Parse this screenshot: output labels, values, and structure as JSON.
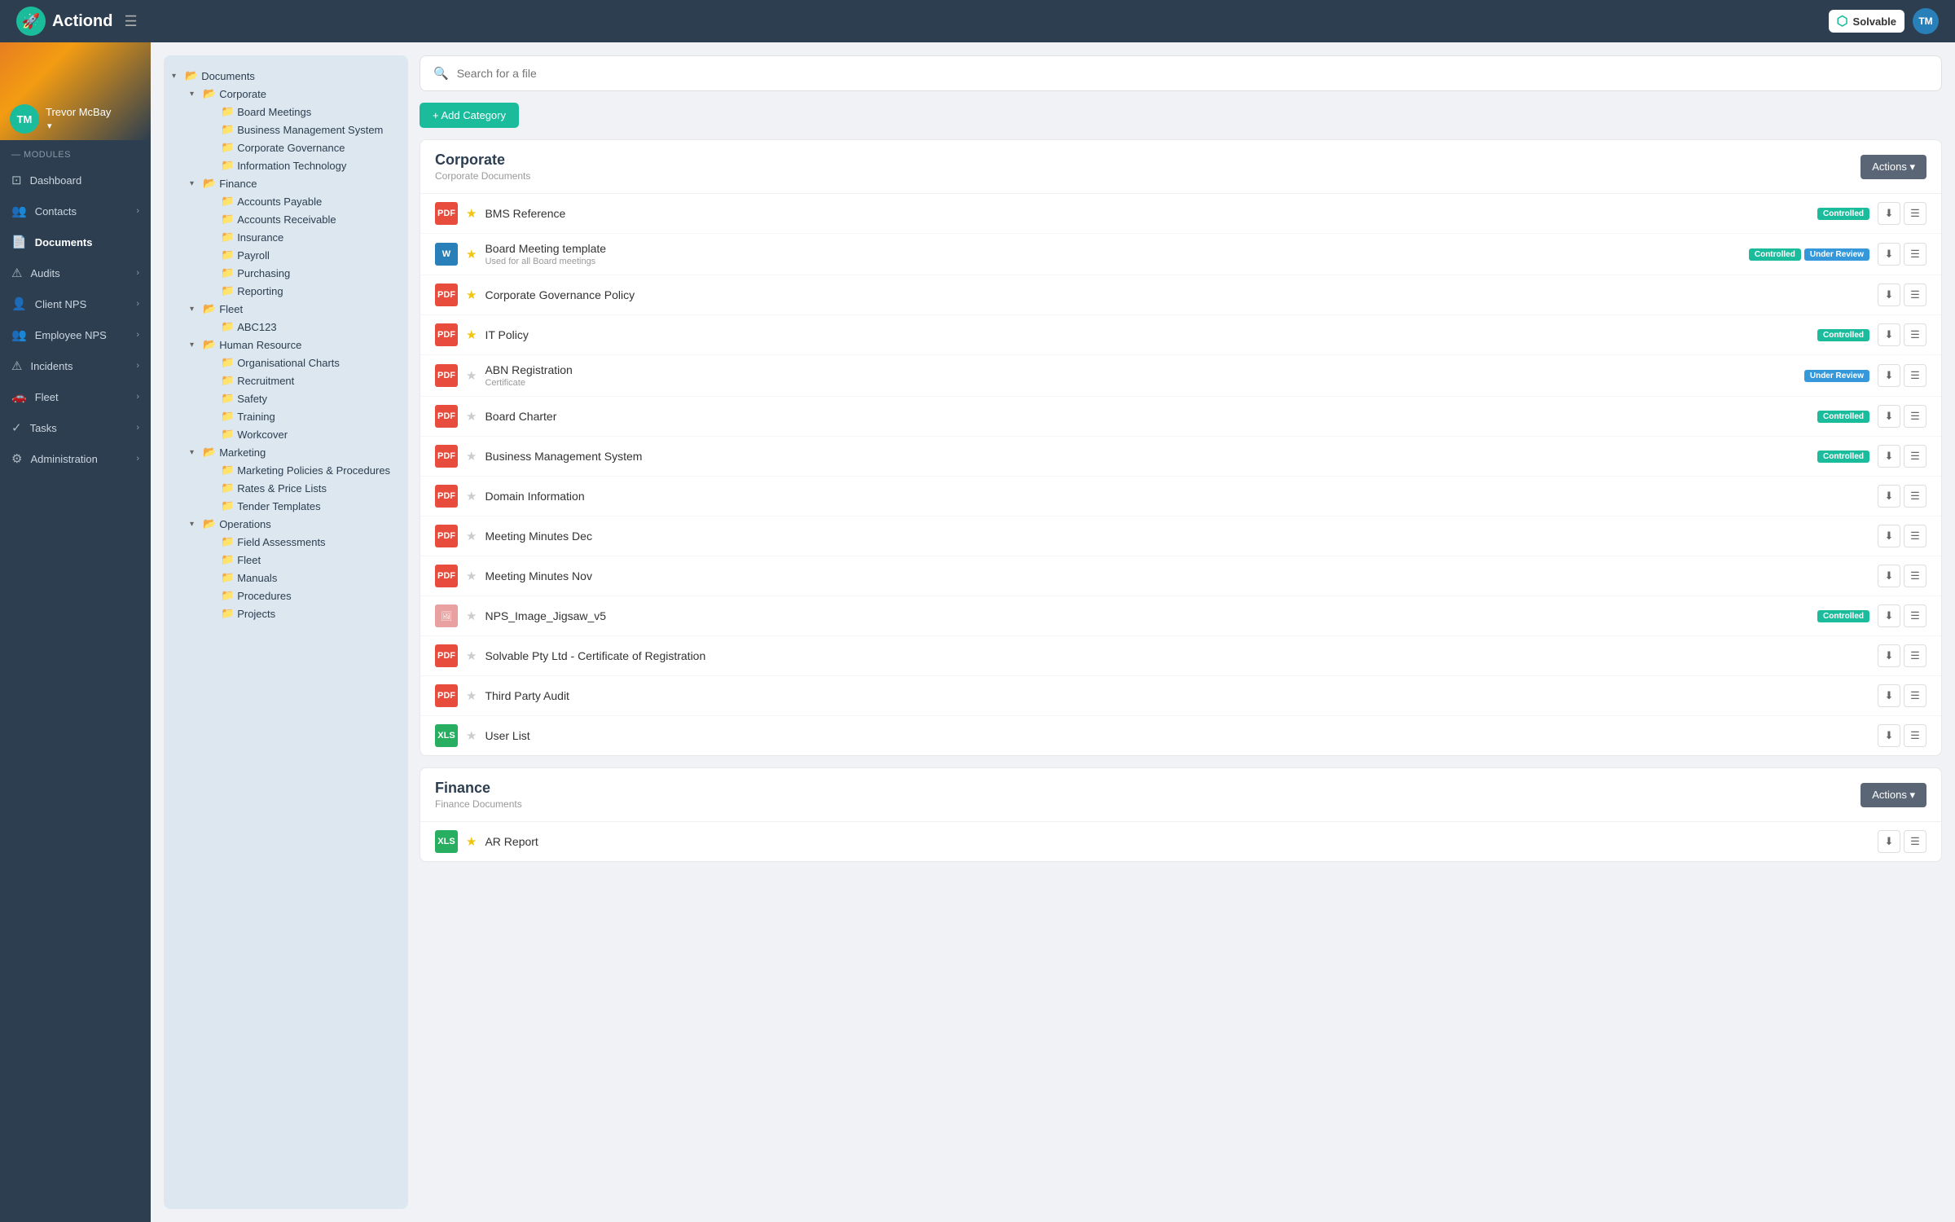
{
  "topNav": {
    "logoIcon": "🚀",
    "appName": "Actiond",
    "hamburgerIcon": "☰",
    "solvableLabel": "Solvable",
    "tmLabel": "TM"
  },
  "sidebar": {
    "userInitials": "TM",
    "userName": "Trevor McBay",
    "modulesLabel": "— MODULES",
    "items": [
      {
        "id": "dashboard",
        "label": "Dashboard",
        "icon": "⊡",
        "hasChevron": false
      },
      {
        "id": "contacts",
        "label": "Contacts",
        "icon": "👥",
        "hasChevron": true
      },
      {
        "id": "documents",
        "label": "Documents",
        "icon": "📄",
        "hasChevron": false,
        "active": true
      },
      {
        "id": "audits",
        "label": "Audits",
        "icon": "⚠",
        "hasChevron": true
      },
      {
        "id": "client-nps",
        "label": "Client NPS",
        "icon": "👤",
        "hasChevron": true
      },
      {
        "id": "employee-nps",
        "label": "Employee NPS",
        "icon": "👥",
        "hasChevron": true
      },
      {
        "id": "incidents",
        "label": "Incidents",
        "icon": "⚠",
        "hasChevron": true
      },
      {
        "id": "fleet",
        "label": "Fleet",
        "icon": "🚗",
        "hasChevron": true
      },
      {
        "id": "tasks",
        "label": "Tasks",
        "icon": "✓",
        "hasChevron": true
      },
      {
        "id": "administration",
        "label": "Administration",
        "icon": "⚙",
        "hasChevron": true
      }
    ]
  },
  "tree": {
    "root": {
      "label": "Documents",
      "expanded": true,
      "children": [
        {
          "label": "Corporate",
          "expanded": true,
          "children": [
            {
              "label": "Board Meetings"
            },
            {
              "label": "Business Management System"
            },
            {
              "label": "Corporate Governance"
            },
            {
              "label": "Information Technology"
            }
          ]
        },
        {
          "label": "Finance",
          "expanded": true,
          "children": [
            {
              "label": "Accounts Payable"
            },
            {
              "label": "Accounts Receivable"
            },
            {
              "label": "Insurance"
            },
            {
              "label": "Payroll"
            },
            {
              "label": "Purchasing"
            },
            {
              "label": "Reporting"
            }
          ]
        },
        {
          "label": "Fleet",
          "expanded": true,
          "children": [
            {
              "label": "ABC123"
            }
          ]
        },
        {
          "label": "Human Resource",
          "expanded": true,
          "children": [
            {
              "label": "Organisational Charts"
            },
            {
              "label": "Recruitment"
            },
            {
              "label": "Safety"
            },
            {
              "label": "Training"
            },
            {
              "label": "Workcover"
            }
          ]
        },
        {
          "label": "Marketing",
          "expanded": true,
          "children": [
            {
              "label": "Marketing Policies & Procedures"
            },
            {
              "label": "Rates & Price Lists"
            },
            {
              "label": "Tender Templates"
            }
          ]
        },
        {
          "label": "Operations",
          "expanded": true,
          "children": [
            {
              "label": "Field Assessments"
            },
            {
              "label": "Fleet"
            },
            {
              "label": "Manuals"
            },
            {
              "label": "Procedures"
            },
            {
              "label": "Projects"
            }
          ]
        }
      ]
    }
  },
  "search": {
    "placeholder": "Search for a file"
  },
  "addCategoryLabel": "+ Add Category",
  "corporate": {
    "title": "Corporate",
    "subtitle": "Corporate Documents",
    "actionsLabel": "Actions ▾",
    "files": [
      {
        "type": "pdf",
        "starred": true,
        "name": "BMS Reference",
        "subtitle": "",
        "badge": "controlled",
        "badgeLabel": "Controlled"
      },
      {
        "type": "docx",
        "starred": true,
        "name": "Board Meeting template",
        "subtitle": "Used for all Board meetings",
        "badge": "under-review",
        "badgeLabel": "Under Review",
        "badge2": "controlled",
        "badge2Label": "Controlled"
      },
      {
        "type": "pdf",
        "starred": true,
        "name": "Corporate Governance Policy",
        "subtitle": "",
        "badge": ""
      },
      {
        "type": "pdf",
        "starred": true,
        "name": "IT Policy",
        "subtitle": "",
        "badge": "controlled",
        "badgeLabel": "Controlled"
      },
      {
        "type": "pdf",
        "starred": false,
        "name": "ABN Registration",
        "subtitle": "Certificate",
        "badge": "under-review",
        "badgeLabel": "Under Review"
      },
      {
        "type": "pdf",
        "starred": false,
        "name": "Board Charter",
        "subtitle": "",
        "badge": "controlled",
        "badgeLabel": "Controlled"
      },
      {
        "type": "pdf",
        "starred": false,
        "name": "Business Management System",
        "subtitle": "",
        "badge": "controlled",
        "badgeLabel": "Controlled"
      },
      {
        "type": "pdf",
        "starred": false,
        "name": "Domain Information",
        "subtitle": "",
        "badge": ""
      },
      {
        "type": "pdf",
        "starred": false,
        "name": "Meeting Minutes Dec",
        "subtitle": "",
        "badge": ""
      },
      {
        "type": "pdf",
        "starred": false,
        "name": "Meeting Minutes Nov",
        "subtitle": "",
        "badge": ""
      },
      {
        "type": "img",
        "starred": false,
        "name": "NPS_Image_Jigsaw_v5",
        "subtitle": "",
        "badge": "controlled",
        "badgeLabel": "Controlled"
      },
      {
        "type": "pdf",
        "starred": false,
        "name": "Solvable Pty Ltd - Certificate of Registration",
        "subtitle": "",
        "badge": ""
      },
      {
        "type": "pdf",
        "starred": false,
        "name": "Third Party Audit",
        "subtitle": "",
        "badge": ""
      },
      {
        "type": "xlsx",
        "starred": false,
        "name": "User List",
        "subtitle": "",
        "badge": ""
      }
    ]
  },
  "finance": {
    "title": "Finance",
    "subtitle": "Finance Documents",
    "actionsLabel": "Actions ▾",
    "files": [
      {
        "type": "xlsx",
        "starred": true,
        "name": "AR Report",
        "subtitle": "",
        "badge": ""
      }
    ]
  }
}
